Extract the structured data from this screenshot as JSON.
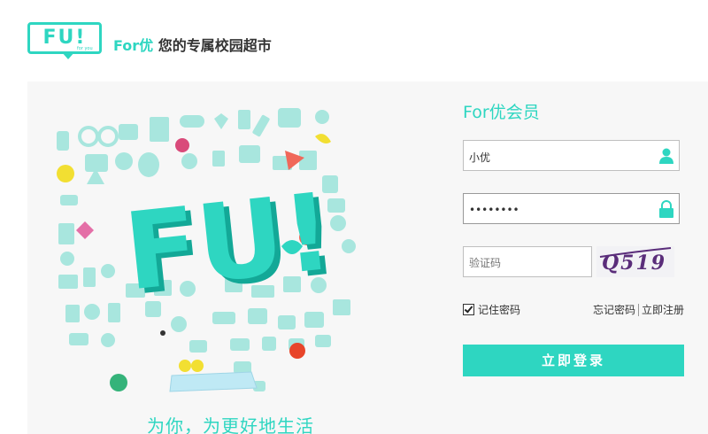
{
  "header": {
    "logo_text": "FU!",
    "logo_sub": "for you",
    "brand": "For优",
    "tagline": " 您的专属校园超市"
  },
  "illustration": {
    "title_text": "FU!",
    "slogan": "为你，为更好地生活"
  },
  "login": {
    "title": "For优会员",
    "username": {
      "value": "小优",
      "icon": "user-icon"
    },
    "password": {
      "value": "••••••••",
      "icon": "lock-icon"
    },
    "captcha": {
      "placeholder": "验证码",
      "image_text": "Q519"
    },
    "remember_label": "记住密码",
    "remember_checked": true,
    "forgot_label": "忘记密码",
    "register_label": "立即注册",
    "submit_label": "立即登录"
  },
  "colors": {
    "accent": "#2ed6c1",
    "background": "#f7f7f7",
    "captcha_text": "#5a2d7a"
  }
}
